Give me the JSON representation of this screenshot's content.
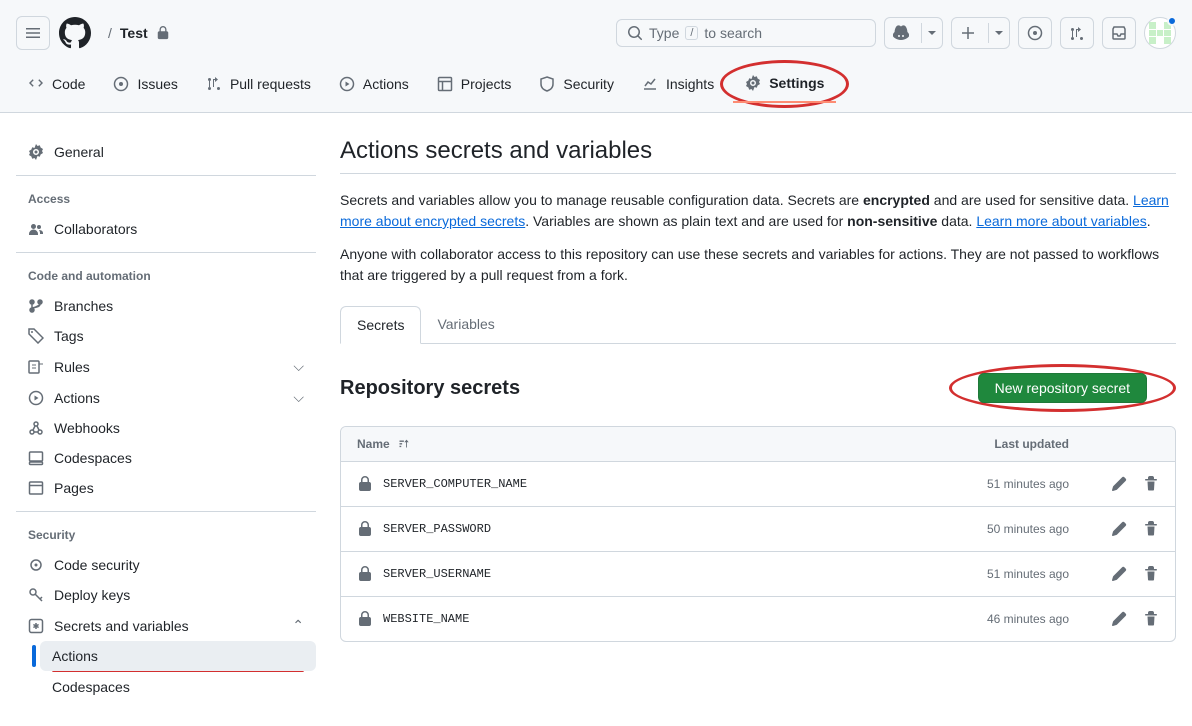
{
  "breadcrumb": {
    "sep": "/",
    "repo": "Test"
  },
  "search": {
    "placeholder": "Type",
    "suffix": "to search",
    "key": "/"
  },
  "repoTabs": {
    "code": "Code",
    "issues": "Issues",
    "pulls": "Pull requests",
    "actions": "Actions",
    "projects": "Projects",
    "security": "Security",
    "insights": "Insights",
    "settings": "Settings"
  },
  "sidebar": {
    "general": "General",
    "accessTitle": "Access",
    "collaborators": "Collaborators",
    "codeTitle": "Code and automation",
    "branches": "Branches",
    "tags": "Tags",
    "rules": "Rules",
    "actions": "Actions",
    "webhooks": "Webhooks",
    "codespaces": "Codespaces",
    "pages": "Pages",
    "securityTitle": "Security",
    "codeSecurity": "Code security",
    "deployKeys": "Deploy keys",
    "secretsVars": "Secrets and variables",
    "sub": {
      "actions": "Actions",
      "codespaces": "Codespaces"
    }
  },
  "page": {
    "title": "Actions secrets and variables",
    "desc1a": "Secrets and variables allow you to manage reusable configuration data. Secrets are ",
    "desc1b": "encrypted",
    "desc1c": " and are used for sensitive data. ",
    "link1": "Learn more about encrypted secrets",
    "desc1d": ". Variables are shown as plain text and are used for ",
    "desc1e": "non-sensitive",
    "desc1f": " data. ",
    "link2": "Learn more about variables",
    "desc1g": ".",
    "desc2": "Anyone with collaborator access to this repository can use these secrets and variables for actions. They are not passed to workflows that are triggered by a pull request from a fork.",
    "tabSecrets": "Secrets",
    "tabVariables": "Variables",
    "repoSecrets": "Repository secrets",
    "newSecret": "New repository secret",
    "colName": "Name",
    "colUpdated": "Last updated"
  },
  "secrets": [
    {
      "name": "SERVER_COMPUTER_NAME",
      "updated": "51 minutes ago"
    },
    {
      "name": "SERVER_PASSWORD",
      "updated": "50 minutes ago"
    },
    {
      "name": "SERVER_USERNAME",
      "updated": "51 minutes ago"
    },
    {
      "name": "WEBSITE_NAME",
      "updated": "46 minutes ago"
    }
  ]
}
